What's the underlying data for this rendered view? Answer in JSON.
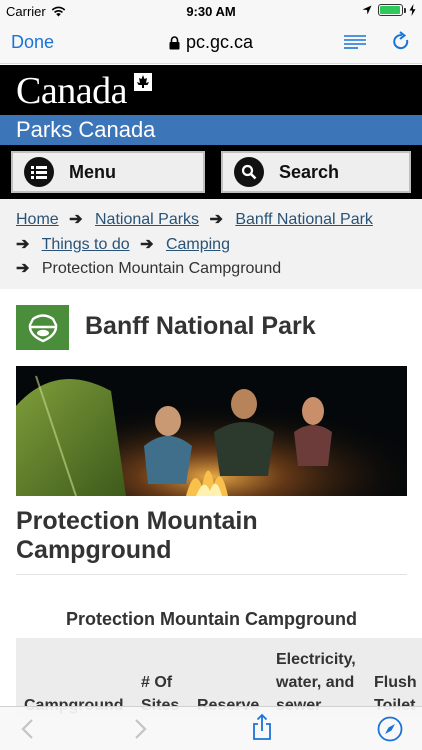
{
  "status_bar": {
    "carrier": "Carrier",
    "time": "9:30 AM",
    "battery_level": 0.95,
    "battery_color": "#2fc85a"
  },
  "browser": {
    "done_label": "Done",
    "url": "pc.gc.ca",
    "accent_color": "#1a73d9",
    "icons": [
      "wifi-icon",
      "lock-icon",
      "reader-mode-icon",
      "reload-icon",
      "back-icon",
      "forward-icon",
      "share-icon",
      "safari-compass-icon"
    ]
  },
  "site_header": {
    "wordmark": "Canada",
    "subtitle": "Parks Canada",
    "subtitle_bg": "#3d75b9",
    "menu_label": "Menu",
    "search_label": "Search"
  },
  "breadcrumb": {
    "links": [
      "Home",
      "National Parks",
      "Banff National Park",
      "Things to do",
      "Camping"
    ],
    "current": "Protection Mountain Campground"
  },
  "park": {
    "name": "Banff National Park",
    "logo_color": "#4a8d3a"
  },
  "page": {
    "title": "Protection Mountain Campground"
  },
  "table": {
    "caption": "Protection Mountain Campground",
    "headers": {
      "campground": "Campground",
      "sites_line1": "# Of",
      "sites_line2": "Sites",
      "reserve": "Reserve",
      "services_line1": "Electricity,",
      "services_line2": "water, and",
      "services_line3": "sewer",
      "flush_line1": "Flush",
      "flush_line2": "Toilet"
    }
  }
}
